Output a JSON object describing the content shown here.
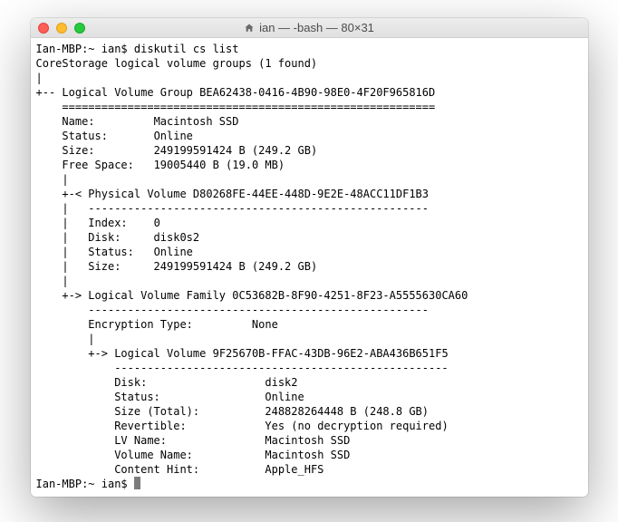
{
  "window": {
    "title": "ian — -bash — 80×31"
  },
  "prompt1": {
    "host": "Ian-MBP:~ ian$ ",
    "command": "diskutil cs list"
  },
  "output": {
    "header": "CoreStorage logical volume groups (1 found)",
    "lvg": {
      "label": "Logical Volume Group",
      "uuid": "BEA62438-0416-4B90-98E0-4F20F965816D",
      "sep": "=========================================================",
      "name_label": "Name:",
      "name": "Macintosh SSD",
      "status_label": "Status:",
      "status": "Online",
      "size_label": "Size:",
      "size": "249199591424 B (249.2 GB)",
      "free_label": "Free Space:",
      "free": "19005440 B (19.0 MB)"
    },
    "pv": {
      "label": "Physical Volume",
      "uuid": "D80268FE-44EE-448D-9E2E-48ACC11DF1B3",
      "sep": "----------------------------------------------------",
      "index_label": "Index:",
      "index": "0",
      "disk_label": "Disk:",
      "disk": "disk0s2",
      "status_label": "Status:",
      "status": "Online",
      "size_label": "Size:",
      "size": "249199591424 B (249.2 GB)"
    },
    "lvf": {
      "label": "Logical Volume Family",
      "uuid": "0C53682B-8F90-4251-8F23-A5555630CA60",
      "sep": "----------------------------------------------------",
      "enc_label": "Encryption Type:",
      "enc": "None"
    },
    "lv": {
      "label": "Logical Volume",
      "uuid": "9F25670B-FFAC-43DB-96E2-ABA436B651F5",
      "sep": "---------------------------------------------------",
      "disk_label": "Disk:",
      "disk": "disk2",
      "status_label": "Status:",
      "status": "Online",
      "size_label": "Size (Total):",
      "size": "248828264448 B (248.8 GB)",
      "rev_label": "Revertible:",
      "rev": "Yes (no decryption required)",
      "lvname_label": "LV Name:",
      "lvname": "Macintosh SSD",
      "volname_label": "Volume Name:",
      "volname": "Macintosh SSD",
      "hint_label": "Content Hint:",
      "hint": "Apple_HFS"
    }
  },
  "prompt2": {
    "host": "Ian-MBP:~ ian$ "
  }
}
